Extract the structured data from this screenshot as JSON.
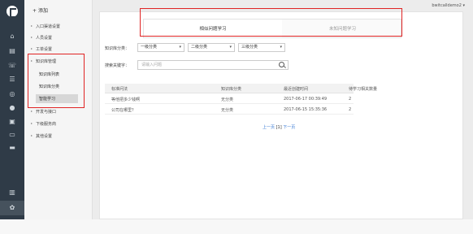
{
  "rail": {
    "icons": [
      "home-icon",
      "doc-icon",
      "phone-icon",
      "list-icon",
      "target-icon",
      "chat-icon",
      "id-icon",
      "db-icon",
      "folder-icon",
      "chart-icon",
      "gear-icon"
    ]
  },
  "submenu": {
    "add_label": "添加",
    "items": [
      "入口渠道设置",
      "人员设置",
      "工单设置",
      "知识库管理",
      "开发与接口",
      "下级服务商",
      "其他设置"
    ],
    "subitems": [
      "知识库列表",
      "知识库分类",
      "智能学习"
    ],
    "active_sub": "智能学习"
  },
  "header": {
    "user": "bwitcalldemo2 ▾"
  },
  "tabs": {
    "learned": "相似问题学习",
    "unlearned": "未知问题学习"
  },
  "filters": {
    "category_label": "知识库分类：",
    "level1": "一级分类",
    "level2": "二级分类",
    "level3": "三级分类",
    "search_label": "搜索关键字：",
    "search_placeholder": "请输入问题"
  },
  "table": {
    "headers": [
      "标准问法",
      "知识库分类",
      "最近创建时间",
      "待学习相关数量"
    ],
    "rows": [
      [
        "等他把多少钱啊",
        "无分类",
        "2017-06-17 00:39:49",
        "2"
      ],
      [
        "公司在哪里？",
        "无分类",
        "2017-06-15 15:35:36",
        "2"
      ]
    ]
  },
  "pager": {
    "prev": "上一页",
    "current": "[1]",
    "next": "下一页"
  }
}
